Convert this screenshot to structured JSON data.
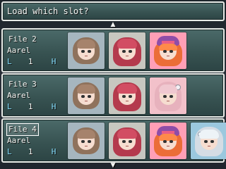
{
  "help": {
    "text": "Load which slot?"
  },
  "icons": {
    "scroll_up": "chevron-up-icon",
    "scroll_down": "chevron-down-icon"
  },
  "slots": [
    {
      "title": "File 2",
      "name": "Aarel",
      "level_label": "L",
      "level": "1",
      "hp_label": "H",
      "hp": "48",
      "selected": false,
      "portraits": [
        "brown-hair",
        "red-hair",
        "orange-hair"
      ]
    },
    {
      "title": "File 3",
      "name": "Aarel",
      "level_label": "L",
      "level": "1",
      "hp_label": "H",
      "hp": "48",
      "selected": false,
      "portraits": [
        "brown-hair",
        "red-hair",
        "pink-silver"
      ]
    },
    {
      "title": "File 4",
      "name": "Aarel",
      "level_label": "L",
      "level": "1",
      "hp_label": "H",
      "hp": "48",
      "selected": true,
      "portraits": [
        "brown-hair",
        "red-hair",
        "orange-hair",
        "white-hair"
      ]
    }
  ],
  "colors": {
    "window_top": "#4b6a69",
    "window_bottom": "#2c4444",
    "stat_label": "#86e0ff",
    "text": "#f7faf7"
  }
}
